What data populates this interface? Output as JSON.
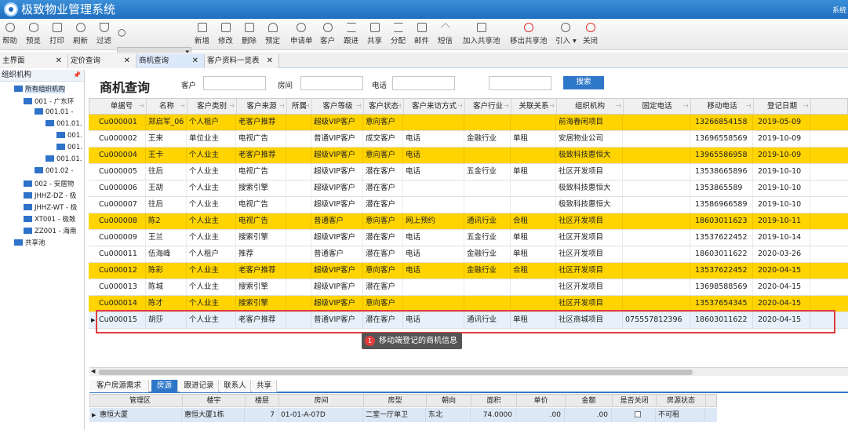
{
  "app": {
    "title": "极致物业管理系统",
    "sys_label": "系统"
  },
  "toolbar": {
    "items": [
      {
        "label": "帮助",
        "icon": "help-icon"
      },
      {
        "label": "预览",
        "icon": "eye-icon"
      },
      {
        "label": "打印",
        "icon": "printer-icon"
      },
      {
        "label": "刷新",
        "icon": "refresh-icon"
      },
      {
        "label": "过滤",
        "icon": "filter-icon"
      },
      {
        "label": "新增",
        "icon": "add-icon"
      },
      {
        "label": "修改",
        "icon": "edit-icon"
      },
      {
        "label": "删除",
        "icon": "trash-icon"
      },
      {
        "label": "预定",
        "icon": "user-icon"
      },
      {
        "label": "申请单",
        "icon": "search-icon"
      },
      {
        "label": "客户",
        "icon": "search-icon"
      },
      {
        "label": "跟进",
        "icon": "transfer-icon"
      },
      {
        "label": "共享",
        "icon": "share-icon"
      },
      {
        "label": "分配",
        "icon": "transfer-icon"
      },
      {
        "label": "邮件",
        "icon": "mail-icon"
      },
      {
        "label": "短信",
        "icon": "chevron-up-icon"
      },
      {
        "label": "加入共享池",
        "icon": "add-icon"
      },
      {
        "label": "移出共享池",
        "icon": "remove-icon"
      },
      {
        "label": "引入",
        "icon": "import-icon"
      },
      {
        "label": "关闭",
        "icon": "power-icon"
      }
    ]
  },
  "tabs": [
    {
      "label": "主界面"
    },
    {
      "label": "定价查询"
    },
    {
      "label": "商机查询"
    },
    {
      "label": "客户资料一览表"
    }
  ],
  "tree": {
    "title": "组织机构",
    "nodes": [
      {
        "label": "所有组织机构"
      },
      {
        "label": "001 - 广东环"
      },
      {
        "label": "001.01 -"
      },
      {
        "label": "001.01."
      },
      {
        "label": "001."
      },
      {
        "label": "001."
      },
      {
        "label": "001.01."
      },
      {
        "label": "001.02 -"
      },
      {
        "label": "002 - 安居物"
      },
      {
        "label": "JHHZ-DZ - 极"
      },
      {
        "label": "JHHZ-WT - 极"
      },
      {
        "label": "XT001 - 极致"
      },
      {
        "label": "ZZ001 - 海南"
      },
      {
        "label": "共享池"
      }
    ]
  },
  "query": {
    "title": "商机查询",
    "customer_label": "客户",
    "room_label": "房间",
    "phone_label": "电话",
    "search_button": "搜索",
    "customer_value": "",
    "room_value": "",
    "phone_value": "",
    "extra_value": ""
  },
  "grid": {
    "columns": [
      "单据号",
      "名称",
      "客户类别",
      "客户来源",
      "所属",
      "客户等级",
      "客户状态",
      "客户来访方式",
      "客户行业",
      "关联关系",
      "组织机构",
      "固定电话",
      "移动电话",
      "登记日期"
    ],
    "rows": [
      {
        "style": "y",
        "cells": [
          "Cu000001",
          "郑启军_06",
          "个人租户",
          "老客户推荐",
          "",
          "超级VIP客户",
          "意向客户",
          "",
          "",
          "",
          "前海春闲项目",
          "",
          "13266854158",
          "2019-05-09"
        ]
      },
      {
        "style": "w",
        "cells": [
          "Cu000002",
          "王来",
          "单位业主",
          "电视广告",
          "",
          "普通VIP客户",
          "成交客户",
          "电话",
          "金融行业",
          "单租",
          "安居物业公司",
          "",
          "13696558569",
          "2019-10-09"
        ]
      },
      {
        "style": "y",
        "cells": [
          "Cu000004",
          "王卡",
          "个人业主",
          "老客户推荐",
          "",
          "超级VIP客户",
          "意向客户",
          "电话",
          "",
          "",
          "极致科技惠恒大",
          "",
          "13965586958",
          "2019-10-09"
        ]
      },
      {
        "style": "w",
        "cells": [
          "Cu000005",
          "往后",
          "个人业主",
          "电视广告",
          "",
          "超级VIP客户",
          "潜在客户",
          "电话",
          "五金行业",
          "单租",
          "社区开发项目",
          "",
          "13538665896",
          "2019-10-10"
        ]
      },
      {
        "style": "w",
        "cells": [
          "Cu000006",
          "王胡",
          "个人业主",
          "搜索引擎",
          "",
          "超级VIP客户",
          "潜在客户",
          "",
          "",
          "",
          "极致科技惠恒大",
          "",
          "1353865589",
          "2019-10-10"
        ]
      },
      {
        "style": "w",
        "cells": [
          "Cu000007",
          "往后",
          "个人业主",
          "电视广告",
          "",
          "超级VIP客户",
          "潜在客户",
          "",
          "",
          "",
          "极致科技惠恒大",
          "",
          "13586966589",
          "2019-10-10"
        ]
      },
      {
        "style": "y",
        "cells": [
          "Cu000008",
          "陈2",
          "个人业主",
          "电视广告",
          "",
          "普通客户",
          "意向客户",
          "网上预约",
          "通讯行业",
          "合租",
          "社区开发项目",
          "",
          "18603011623",
          "2019-10-11"
        ]
      },
      {
        "style": "w",
        "cells": [
          "Cu000009",
          "王兰",
          "个人业主",
          "搜索引擎",
          "",
          "超级VIP客户",
          "潜在客户",
          "电话",
          "五金行业",
          "单租",
          "社区开发项目",
          "",
          "13537622452",
          "2019-10-14"
        ]
      },
      {
        "style": "w",
        "cells": [
          "Cu000011",
          "伍海峰",
          "个人租户",
          "推荐",
          "",
          "普通客户",
          "潜在客户",
          "电话",
          "金融行业",
          "单租",
          "社区开发项目",
          "",
          "18603011622",
          "2020-03-26"
        ]
      },
      {
        "style": "y",
        "cells": [
          "Cu000012",
          "陈彩",
          "个人业主",
          "老客户推荐",
          "",
          "超级VIP客户",
          "意向客户",
          "电话",
          "金融行业",
          "合租",
          "社区开发项目",
          "",
          "13537622452",
          "2020-04-15"
        ]
      },
      {
        "style": "w",
        "cells": [
          "Cu000013",
          "陈城",
          "个人业主",
          "搜索引擎",
          "",
          "超级VIP客户",
          "潜在客户",
          "",
          "",
          "",
          "社区开发项目",
          "",
          "13698588569",
          "2020-04-15"
        ]
      },
      {
        "style": "y",
        "cells": [
          "Cu000014",
          "陈才",
          "个人业主",
          "搜索引擎",
          "",
          "超级VIP客户",
          "意向客户",
          "",
          "",
          "",
          "社区开发项目",
          "",
          "13537654345",
          "2020-04-15"
        ]
      },
      {
        "style": "b",
        "cells": [
          "Cu000015",
          "胡莎",
          "个人业主",
          "老客户推荐",
          "",
          "普通VIP客户",
          "潜在客户",
          "电话",
          "通讯行业",
          "单租",
          "社区商城项目",
          "075557812396",
          "18603011622",
          "2020-04-15"
        ]
      }
    ]
  },
  "tooltip": {
    "badge": "1",
    "text": "移动端登记的商机信息"
  },
  "bottom_tabs": [
    {
      "label": "客户房源需求"
    },
    {
      "label": "房源"
    },
    {
      "label": "跟进记录"
    },
    {
      "label": "联系人"
    },
    {
      "label": "共享"
    }
  ],
  "subgrid": {
    "columns": [
      "管理区",
      "楼宇",
      "楼层",
      "房间",
      "房型",
      "朝向",
      "面积",
      "单价",
      "金额",
      "是否关闭",
      "房源状态"
    ],
    "rows": [
      {
        "cells": [
          "惠恒大厦",
          "惠恒大厦1栋",
          "7",
          "01-01-A-07D",
          "二室一厅单卫",
          "东北",
          "74.0000",
          ".00",
          ".00",
          "",
          "不可租"
        ]
      }
    ]
  }
}
